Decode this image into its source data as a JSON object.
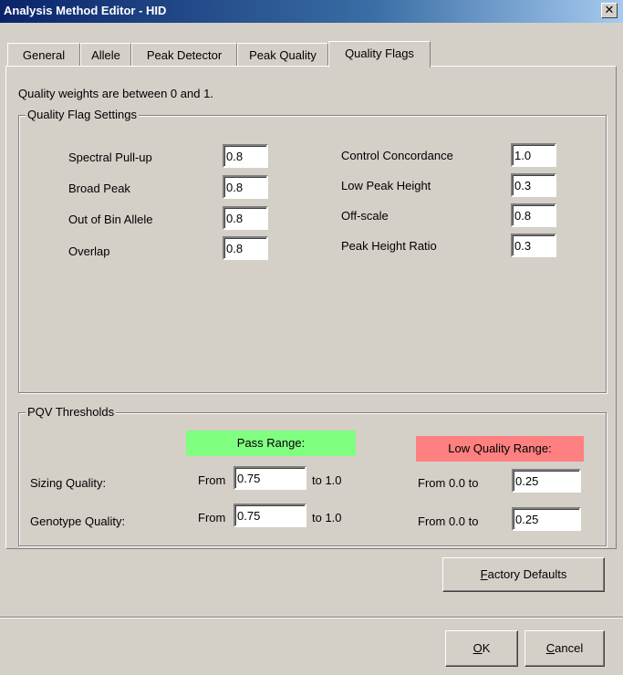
{
  "window": {
    "title": "Analysis Method Editor - HID",
    "close_glyph": "✕"
  },
  "tabs": [
    {
      "label": "General"
    },
    {
      "label": "Allele"
    },
    {
      "label": "Peak Detector"
    },
    {
      "label": "Peak Quality"
    },
    {
      "label": "Quality Flags",
      "active": true
    }
  ],
  "info": "Quality weights are between 0 and 1.",
  "quality_flags": {
    "legend": "Quality Flag Settings",
    "left": [
      {
        "label": "Spectral Pull-up",
        "value": "0.8"
      },
      {
        "label": "Broad Peak",
        "value": "0.8"
      },
      {
        "label": "Out of Bin Allele",
        "value": "0.8"
      },
      {
        "label": "Overlap",
        "value": "0.8"
      }
    ],
    "right": [
      {
        "label": "Control Concordance",
        "value": "1.0"
      },
      {
        "label": "Low Peak Height",
        "value": "0.3"
      },
      {
        "label": "Off-scale",
        "value": "0.8"
      },
      {
        "label": "Peak Height Ratio",
        "value": "0.3"
      }
    ]
  },
  "pqv": {
    "legend": "PQV Thresholds",
    "pass_range_label": "Pass Range:",
    "low_range_label": "Low Quality Range:",
    "pass_color": "#80ff80",
    "low_color": "#ff8080",
    "rows": [
      {
        "label": "Sizing Quality:",
        "from_label": "From",
        "from_value": "0.75",
        "to_label": "to 1.0",
        "low_label": "From 0.0 to",
        "low_value": "0.25"
      },
      {
        "label": "Genotype Quality:",
        "from_label": "From",
        "from_value": "0.75",
        "to_label": "to 1.0",
        "low_label": "From 0.0 to",
        "low_value": "0.25"
      }
    ]
  },
  "buttons": {
    "factory_defaults": {
      "label": "Factory Defaults",
      "mnemonic": "F",
      "rest": "actory Defaults"
    },
    "ok": {
      "label": "OK",
      "mnemonic": "O",
      "rest": "K"
    },
    "cancel": {
      "label": "Cancel",
      "mnemonic": "C",
      "rest": "ancel"
    }
  }
}
